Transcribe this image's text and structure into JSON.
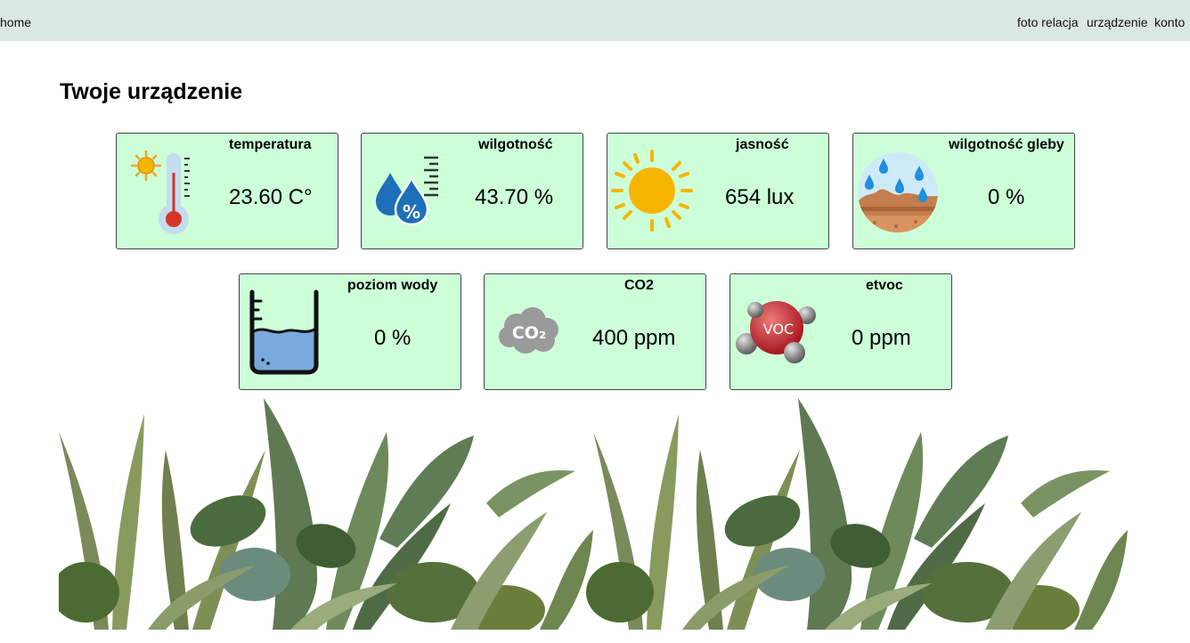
{
  "nav": {
    "home_label": "home",
    "links": [
      "foto relacja",
      "urządzenie",
      "konto"
    ]
  },
  "page": {
    "title": "Twoje urządzenie"
  },
  "sensors": [
    {
      "title": "temperatura",
      "value": "23.60 C°",
      "icon": "thermometer-icon"
    },
    {
      "title": "wilgotność",
      "value": "43.70 %",
      "icon": "humidity-icon"
    },
    {
      "title": "jasność",
      "value": "654 lux",
      "icon": "sun-icon"
    },
    {
      "title": "wilgotność gleby",
      "value": "0 %",
      "icon": "soil-moisture-icon"
    },
    {
      "title": "poziom wody",
      "value": "0 %",
      "icon": "water-level-icon"
    },
    {
      "title": "CO2",
      "value": "400 ppm",
      "icon": "co2-cloud-icon"
    },
    {
      "title": "etvoc",
      "value": "0 ppm",
      "icon": "voc-molecule-icon"
    }
  ],
  "colors": {
    "nav_background": "#d9e8e1",
    "card_background": "#ccffd8",
    "card_border": "#444444",
    "sun": "#f7b500",
    "water": "#1d6fb8"
  },
  "decoration": {
    "icon": "tropical-plants-illustration"
  }
}
